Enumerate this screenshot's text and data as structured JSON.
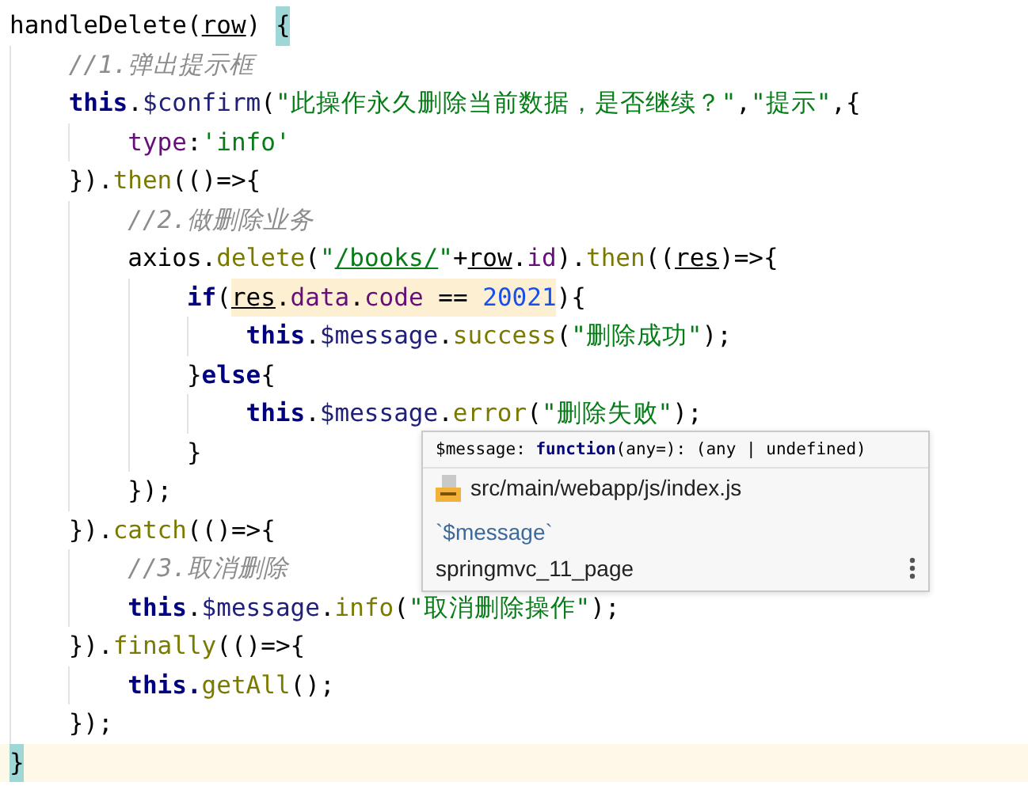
{
  "editor": {
    "lines": [
      {
        "current": false,
        "tokens": [
          {
            "t": "handleDelete(",
            "kind": "plain"
          },
          {
            "t": "row",
            "kind": "param"
          },
          {
            "t": ") ",
            "kind": "plain"
          },
          {
            "t": "{",
            "kind": "brace-match"
          }
        ],
        "children": [
          {
            "current": false,
            "tokens": [
              {
                "t": "//1.弹出提示框",
                "kind": "comment"
              }
            ]
          },
          {
            "current": false,
            "tokens": [
              {
                "t": "this",
                "kind": "keyword"
              },
              {
                "t": ".",
                "kind": "plain"
              },
              {
                "t": "$confirm",
                "kind": "fn"
              },
              {
                "t": "(",
                "kind": "plain"
              },
              {
                "t": "\"此操作永久删除当前数据，是否继续？\"",
                "kind": "string"
              },
              {
                "t": ",",
                "kind": "plain"
              },
              {
                "t": "\"提示\"",
                "kind": "string"
              },
              {
                "t": ",{",
                "kind": "plain"
              }
            ],
            "children": [
              {
                "current": false,
                "tokens": [
                  {
                    "t": "type",
                    "kind": "member"
                  },
                  {
                    "t": ":",
                    "kind": "plain"
                  },
                  {
                    "t": "'info'",
                    "kind": "string"
                  }
                ]
              }
            ]
          },
          {
            "current": false,
            "tokens": [
              {
                "t": "}).",
                "kind": "plain"
              },
              {
                "t": "then",
                "kind": "call"
              },
              {
                "t": "(()=>{",
                "kind": "plain"
              }
            ],
            "children": [
              {
                "current": false,
                "tokens": [
                  {
                    "t": "//2.做删除业务",
                    "kind": "comment"
                  }
                ]
              },
              {
                "current": false,
                "tokens": [
                  {
                    "t": "axios.",
                    "kind": "plain"
                  },
                  {
                    "t": "delete",
                    "kind": "call"
                  },
                  {
                    "t": "(",
                    "kind": "plain"
                  },
                  {
                    "t": "\"",
                    "kind": "string"
                  },
                  {
                    "t": "/books/",
                    "kind": "path"
                  },
                  {
                    "t": "\"",
                    "kind": "string"
                  },
                  {
                    "t": "+",
                    "kind": "plain"
                  },
                  {
                    "t": "row",
                    "kind": "param"
                  },
                  {
                    "t": ".",
                    "kind": "plain"
                  },
                  {
                    "t": "id",
                    "kind": "member"
                  },
                  {
                    "t": ").",
                    "kind": "plain"
                  },
                  {
                    "t": "then",
                    "kind": "call"
                  },
                  {
                    "t": "((",
                    "kind": "plain"
                  },
                  {
                    "t": "res",
                    "kind": "param"
                  },
                  {
                    "t": ")=>{",
                    "kind": "plain"
                  }
                ],
                "children": [
                  {
                    "current": false,
                    "tokens": [
                      {
                        "t": "if",
                        "kind": "keyword"
                      },
                      {
                        "t": "(",
                        "kind": "plain"
                      },
                      {
                        "kind": "highlight",
                        "parts": [
                          {
                            "t": "res",
                            "kind": "param"
                          },
                          {
                            "t": ".",
                            "kind": "plain"
                          },
                          {
                            "t": "data",
                            "kind": "member"
                          },
                          {
                            "t": ".",
                            "kind": "plain"
                          },
                          {
                            "t": "code",
                            "kind": "member"
                          },
                          {
                            "t": " == ",
                            "kind": "plain"
                          },
                          {
                            "t": "20021",
                            "kind": "number"
                          }
                        ]
                      },
                      {
                        "t": "){",
                        "kind": "plain"
                      }
                    ],
                    "children": [
                      {
                        "current": false,
                        "tokens": [
                          {
                            "t": "this",
                            "kind": "keyword"
                          },
                          {
                            "t": ".",
                            "kind": "plain"
                          },
                          {
                            "t": "$message",
                            "kind": "fn"
                          },
                          {
                            "t": ".",
                            "kind": "plain"
                          },
                          {
                            "t": "success",
                            "kind": "call"
                          },
                          {
                            "t": "(",
                            "kind": "plain"
                          },
                          {
                            "t": "\"删除成功\"",
                            "kind": "string"
                          },
                          {
                            "t": ");",
                            "kind": "plain"
                          }
                        ]
                      }
                    ]
                  },
                  {
                    "current": false,
                    "tokens": [
                      {
                        "t": "}",
                        "kind": "plain"
                      },
                      {
                        "t": "else",
                        "kind": "keyword"
                      },
                      {
                        "t": "{",
                        "kind": "plain"
                      }
                    ],
                    "children": [
                      {
                        "current": false,
                        "tokens": [
                          {
                            "t": "this",
                            "kind": "keyword"
                          },
                          {
                            "t": ".",
                            "kind": "plain"
                          },
                          {
                            "t": "$message",
                            "kind": "fn"
                          },
                          {
                            "t": ".",
                            "kind": "plain"
                          },
                          {
                            "t": "error",
                            "kind": "call"
                          },
                          {
                            "t": "(",
                            "kind": "plain"
                          },
                          {
                            "t": "\"删除失败\"",
                            "kind": "string"
                          },
                          {
                            "t": ");",
                            "kind": "plain"
                          }
                        ]
                      }
                    ]
                  },
                  {
                    "current": false,
                    "tokens": [
                      {
                        "t": "}",
                        "kind": "plain"
                      }
                    ]
                  }
                ]
              },
              {
                "current": false,
                "tokens": [
                  {
                    "t": "});",
                    "kind": "plain"
                  }
                ]
              }
            ]
          },
          {
            "current": false,
            "tokens": [
              {
                "t": "}).",
                "kind": "plain"
              },
              {
                "t": "catch",
                "kind": "call"
              },
              {
                "t": "(()=>{",
                "kind": "plain"
              }
            ],
            "children": [
              {
                "current": false,
                "tokens": [
                  {
                    "t": "//3.取消删除",
                    "kind": "comment"
                  }
                ]
              },
              {
                "current": false,
                "tokens": [
                  {
                    "t": "this",
                    "kind": "keyword"
                  },
                  {
                    "t": ".",
                    "kind": "plain"
                  },
                  {
                    "t": "$message",
                    "kind": "fn"
                  },
                  {
                    "t": ".",
                    "kind": "plain"
                  },
                  {
                    "t": "info",
                    "kind": "call"
                  },
                  {
                    "t": "(",
                    "kind": "plain"
                  },
                  {
                    "t": "\"取消删除操作\"",
                    "kind": "string"
                  },
                  {
                    "t": ");",
                    "kind": "plain"
                  }
                ]
              }
            ]
          },
          {
            "current": false,
            "tokens": [
              {
                "t": "}).",
                "kind": "plain"
              },
              {
                "t": "finally",
                "kind": "call"
              },
              {
                "t": "(()=>{",
                "kind": "plain"
              }
            ],
            "children": [
              {
                "current": false,
                "tokens": [
                  {
                    "t": "this.",
                    "kind": "keyword"
                  },
                  {
                    "t": "getAll",
                    "kind": "call"
                  },
                  {
                    "t": "();",
                    "kind": "plain"
                  }
                ]
              }
            ]
          },
          {
            "current": false,
            "tokens": [
              {
                "t": "});",
                "kind": "plain"
              }
            ]
          }
        ]
      },
      {
        "current": true,
        "tokens": [
          {
            "t": "}",
            "kind": "brace-match"
          }
        ]
      }
    ]
  },
  "popup": {
    "signature": [
      {
        "t": "$message: ",
        "kind": "plain"
      },
      {
        "t": "function",
        "kind": "keyword"
      },
      {
        "t": "(any=): (any | undefined)",
        "kind": "plain"
      }
    ],
    "file_path": "src/main/webapp/js/index.js",
    "symbol": "`$message`",
    "project": "springmvc_11_page"
  }
}
